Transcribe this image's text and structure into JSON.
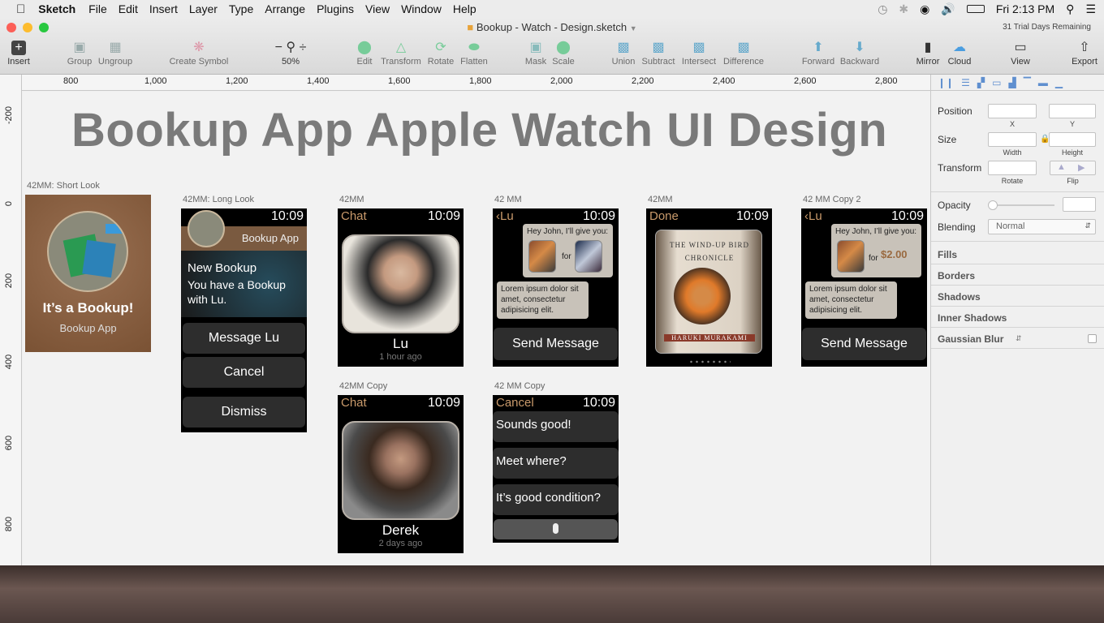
{
  "menubar": {
    "app": "Sketch",
    "items": [
      "File",
      "Edit",
      "Insert",
      "Layer",
      "Type",
      "Arrange",
      "Plugins",
      "View",
      "Window",
      "Help"
    ],
    "clock": "Fri 2:13 PM"
  },
  "window": {
    "title": "Bookup - Watch - Design.sketch",
    "trial": "31 Trial Days Remaining"
  },
  "toolbar": {
    "insert": "Insert",
    "group": "Group",
    "ungroup": "Ungroup",
    "create_symbol": "Create Symbol",
    "zoom": "50%",
    "edit": "Edit",
    "transform": "Transform",
    "rotate": "Rotate",
    "flatten": "Flatten",
    "mask": "Mask",
    "scale": "Scale",
    "union": "Union",
    "subtract": "Subtract",
    "intersect": "Intersect",
    "difference": "Difference",
    "forward": "Forward",
    "backward": "Backward",
    "mirror": "Mirror",
    "cloud": "Cloud",
    "view": "View",
    "export": "Export"
  },
  "ruler_h": [
    "800",
    "1,000",
    "1,200",
    "1,400",
    "1,600",
    "1,800",
    "2,000",
    "2,200",
    "2,400",
    "2,600",
    "2,800"
  ],
  "ruler_v": [
    "-200",
    "0",
    "200",
    "400",
    "600",
    "800"
  ],
  "canvas": {
    "heading": "Bookup App Apple Watch UI Design",
    "short_look": {
      "label": "42MM: Short Look",
      "title": "It’s a Bookup!",
      "subtitle": "Bookup App"
    },
    "long_look": {
      "label": "42MM: Long Look",
      "time": "10:09",
      "app": "Bookup App",
      "message_title": "New Bookup",
      "message_body": "You have a Bookup with Lu.",
      "btn1": "Message Lu",
      "btn2": "Cancel",
      "btn3": "Dismiss"
    },
    "chat1": {
      "label": "42MM",
      "back": "Chat",
      "time": "10:09",
      "name": "Lu",
      "ago": "1 hour ago"
    },
    "msg1": {
      "label": "42 MM",
      "back": "‹Lu",
      "time": "10:09",
      "offer": "Hey John, I’ll give you:",
      "for": "for",
      "reply": "Lorem ipsum dolor sit amet, consectetur adipisicing elit.",
      "send": "Send Message"
    },
    "book": {
      "label": "42MM",
      "back": "Done",
      "time": "10:09",
      "book_title": "THE WIND-UP BIRD CHRONICLE",
      "author": "HARUKI MURAKAMI"
    },
    "msg2": {
      "label": "42 MM Copy 2",
      "back": "‹Lu",
      "time": "10:09",
      "offer": "Hey John, I’ll give you:",
      "for": "for",
      "price": "$2.00",
      "reply": "Lorem ipsum dolor sit amet, consectetur adipisicing elit.",
      "send": "Send Message"
    },
    "chat2": {
      "label": "42MM Copy",
      "back": "Chat",
      "time": "10:09",
      "name": "Derek",
      "ago": "2 days ago"
    },
    "replies": {
      "label": "42 MM Copy",
      "back": "Cancel",
      "time": "10:09",
      "r1": "Sounds good!",
      "r2": "Meet where?",
      "r3": "It’s good condition?"
    }
  },
  "inspector": {
    "position": "Position",
    "x": "X",
    "y": "Y",
    "size": "Size",
    "width": "Width",
    "height": "Height",
    "transform": "Transform",
    "rotate": "Rotate",
    "flip": "Flip",
    "opacity": "Opacity",
    "blending": "Blending",
    "blend_value": "Normal",
    "fills": "Fills",
    "borders": "Borders",
    "shadows": "Shadows",
    "inner_shadows": "Inner Shadows",
    "gaussian_blur": "Gaussian Blur"
  }
}
